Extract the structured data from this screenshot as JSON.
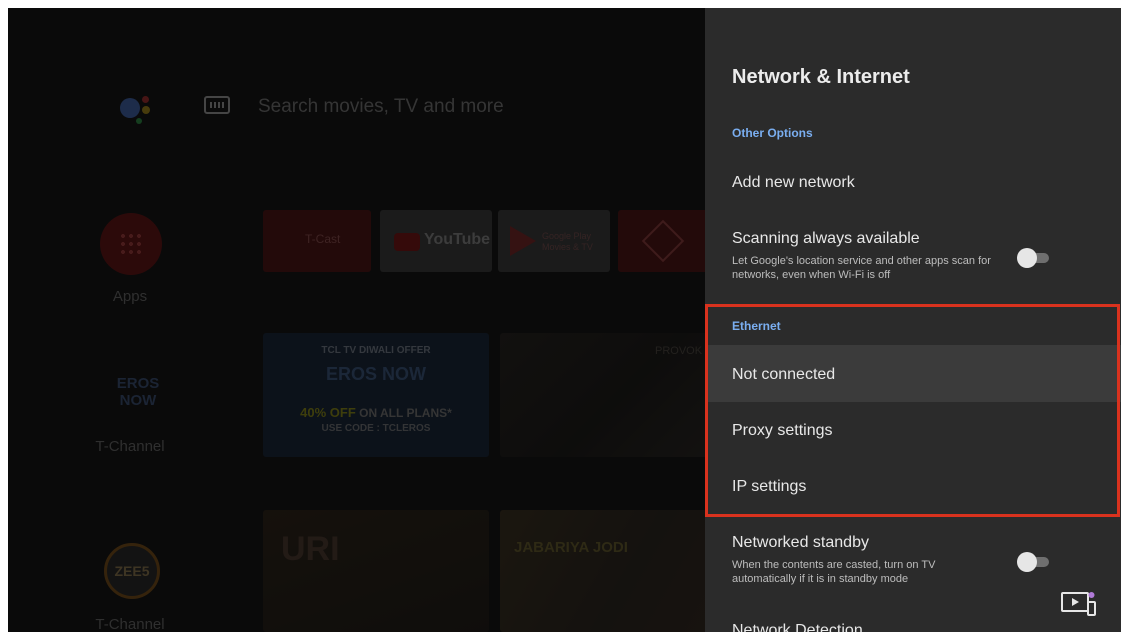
{
  "home": {
    "search_placeholder": "Search movies, TV and more",
    "side_channels": [
      "Apps",
      "T-Channel",
      "T-Channel"
    ],
    "tiles": {
      "tcast": "T-Cast",
      "youtube": "YouTube",
      "google_play": "Google Play Movies & TV"
    },
    "promo": {
      "line1": "TCL TV DIWALI OFFER",
      "brand": "EROS NOW",
      "offer_highlight": "40% OFF",
      "offer_rest": " ON ALL PLANS*",
      "code": "USE CODE : TCLEROS"
    },
    "movie_text": "PROVOK",
    "uri_title": "URI",
    "jabariya_title": "JABARIYA JODI",
    "eros_logo": "EROS NOW",
    "zee_logo": "ZEE5"
  },
  "panel": {
    "title": "Network & Internet",
    "other_options_header": "Other Options",
    "add_network": "Add new network",
    "scanning": {
      "label": "Scanning always available",
      "desc": "Let Google's location service and other apps scan for networks, even when Wi-Fi is off",
      "state": "off"
    },
    "ethernet_header": "Ethernet",
    "ethernet_items": [
      "Not connected",
      "Proxy settings",
      "IP settings"
    ],
    "standby": {
      "label": "Networked standby",
      "desc": "When the contents are casted, turn on TV automatically if it is in standby mode",
      "state": "off"
    },
    "partial_item": "Network Detection"
  },
  "colors": {
    "panel_bg": "#2b2b2b",
    "section_header": "#7aaef0",
    "highlight_border": "#d9321e"
  }
}
